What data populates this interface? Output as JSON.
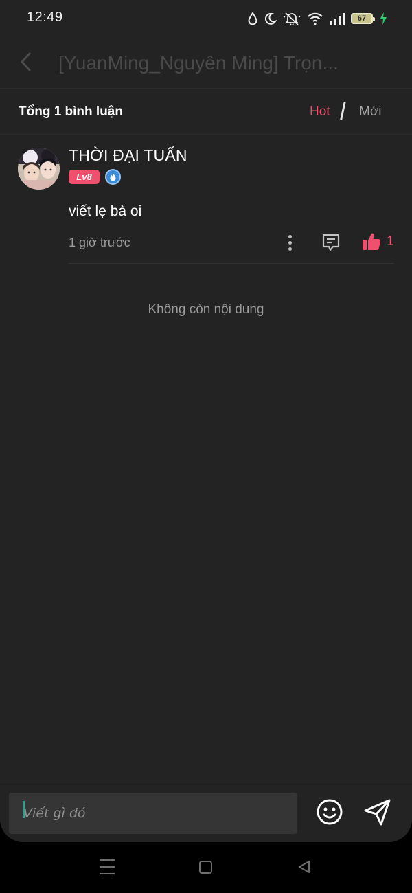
{
  "status_bar": {
    "time": "12:49",
    "battery_level": "67",
    "icons": [
      "water-drop-icon",
      "moon-icon",
      "bell-off-icon",
      "wifi-icon",
      "signal-icon",
      "battery-icon",
      "charging-icon"
    ]
  },
  "header": {
    "back_icon": "chevron-left-icon",
    "title": "[YuanMing_Nguyên Ming] Trọn..."
  },
  "comments": {
    "total_label": "Tổng 1 bình luận",
    "sort_hot": "Hot",
    "sort_new": "Mới",
    "items": [
      {
        "username": "THỜI ĐẠI TUẤN",
        "level": "Lv8",
        "text": "viết lẹ bà oi",
        "time": "1 giờ trước",
        "likes": "1"
      }
    ],
    "end_message": "Không còn nội dung"
  },
  "input": {
    "placeholder": "Viết gì đó"
  },
  "colors": {
    "background": "#232323",
    "accent": "#f0506e",
    "muted_text": "#9b9b9b",
    "input_background": "#353535",
    "cursor": "#1ea896"
  }
}
